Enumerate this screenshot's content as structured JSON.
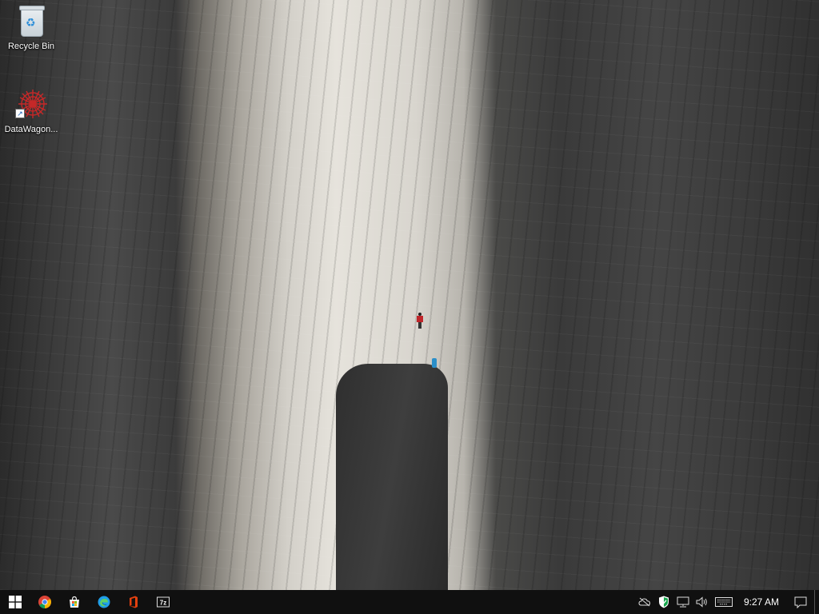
{
  "desktop": {
    "icons": [
      {
        "label": "Recycle Bin",
        "icon": "recycle-bin-icon"
      },
      {
        "label": "DataWagon...",
        "icon": "datawagon-icon"
      }
    ]
  },
  "taskbar": {
    "pinned": [
      {
        "name": "start",
        "icon": "windows-logo-icon"
      },
      {
        "name": "chrome",
        "icon": "chrome-icon"
      },
      {
        "name": "store",
        "icon": "microsoft-store-icon"
      },
      {
        "name": "edge",
        "icon": "edge-icon"
      },
      {
        "name": "office",
        "icon": "office-icon"
      },
      {
        "name": "7zip",
        "icon": "seven-zip-icon"
      }
    ],
    "tray": {
      "icons": [
        "cloud-offline-icon",
        "security-shield-icon",
        "network-icon",
        "volume-icon",
        "keyboard-icon"
      ],
      "clock": "9:27 AM",
      "notification_icon": "action-center-icon"
    }
  },
  "colors": {
    "taskbar_bg": "#101010",
    "chrome_red": "#db4437",
    "chrome_yellow": "#f4b400",
    "chrome_green": "#0f9d58",
    "chrome_blue": "#4285f4",
    "edge_blue": "#1f9ee8",
    "office_orange": "#e3400f",
    "security_green": "#15a54b"
  }
}
